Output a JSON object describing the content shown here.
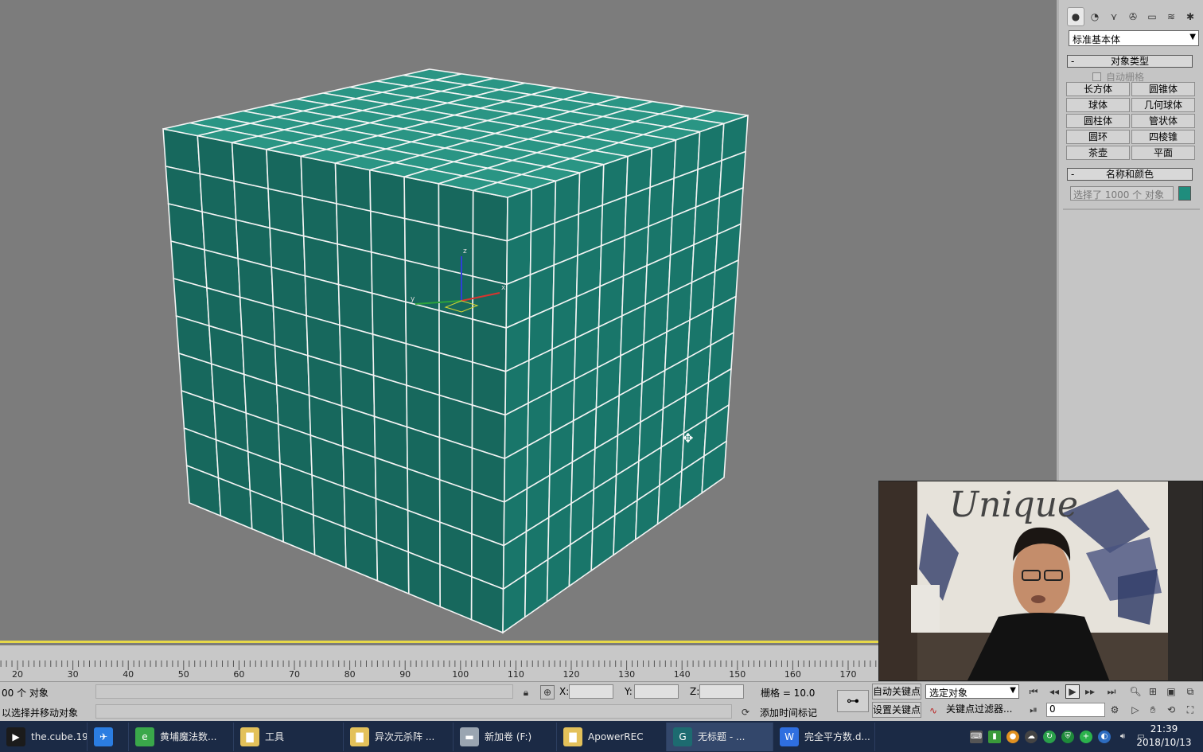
{
  "command_panel": {
    "tabs": [
      {
        "icon": "create-sphere-icon",
        "glyph": "●"
      },
      {
        "icon": "modify-icon",
        "glyph": "◔"
      },
      {
        "icon": "hierarchy-icon",
        "glyph": "⋎"
      },
      {
        "icon": "motion-icon",
        "glyph": "✇"
      },
      {
        "icon": "display-icon",
        "glyph": "▭"
      },
      {
        "icon": "utilities-icon",
        "glyph": "≋"
      },
      {
        "icon": "extra-icon",
        "glyph": "✱"
      }
    ],
    "category_dropdown": "标准基本体",
    "object_type": {
      "header": "对象类型",
      "collapse": "-",
      "autogrid": "自动栅格",
      "buttons": [
        "长方体",
        "圆锥体",
        "球体",
        "几何球体",
        "圆柱体",
        "管状体",
        "圆环",
        "四棱锥",
        "茶壶",
        "平面"
      ]
    },
    "name_color": {
      "header": "名称和颜色",
      "collapse": "-",
      "name_value": "选择了 1000 个 对象",
      "color": "#1f8d7d"
    }
  },
  "viewport": {
    "cube_color_front": "#17685d",
    "cube_color_side": "#19766a",
    "cube_color_top": "#2a9584",
    "background": "#7c7c7c",
    "grid_divisions": 10,
    "gizmo_axes": [
      "z",
      "y",
      "x"
    ]
  },
  "timeline": {
    "ticks": [
      "20",
      "30",
      "40",
      "50",
      "60",
      "70",
      "80",
      "90",
      "100",
      "110",
      "120",
      "130",
      "140",
      "150",
      "160",
      "170"
    ]
  },
  "status": {
    "selection": "00 个 对象",
    "prompt": "以选择并移动对象",
    "x_label": "X:",
    "y_label": "Y:",
    "z_label": "Z:",
    "grid": "栅格 = 10.0",
    "add_time_tag": "添加时间标记",
    "auto_key": "自动关键点",
    "set_key": "设置关键点",
    "selected_object": "选定对象",
    "key_filters": "关键点过滤器...",
    "frame": "0"
  },
  "taskbar": {
    "items": [
      {
        "label": "the.cube.19...",
        "icon": "video-icon",
        "color": "#1b1b1b",
        "glyph": "▶"
      },
      {
        "label": "",
        "icon": "bird-app-icon",
        "color": "#2b7de1",
        "glyph": "✈"
      },
      {
        "label": "黄埔魔法数...",
        "icon": "browser-icon",
        "color": "#3aa84a",
        "glyph": "e"
      },
      {
        "label": "工具",
        "icon": "folder-icon",
        "color": "#e3c15a",
        "glyph": "▇"
      },
      {
        "label": "异次元杀阵 ...",
        "icon": "folder-icon",
        "color": "#e3c15a",
        "glyph": "▇"
      },
      {
        "label": "新加卷 (F:)",
        "icon": "drive-icon",
        "color": "#9aa5b1",
        "glyph": "▬"
      },
      {
        "label": "ApowerREC",
        "icon": "folder-icon",
        "color": "#e3c15a",
        "glyph": "▇"
      },
      {
        "label": "无标题 - ...",
        "icon": "3dsmax-icon",
        "color": "#1d6b70",
        "glyph": "G"
      },
      {
        "label": "完全平方数.d...",
        "icon": "wps-icon",
        "color": "#2f6fe0",
        "glyph": "W"
      }
    ],
    "clock_time": "21:39",
    "clock_date": "2018/10/13"
  },
  "webcam": {
    "banner_text": "Unique"
  }
}
